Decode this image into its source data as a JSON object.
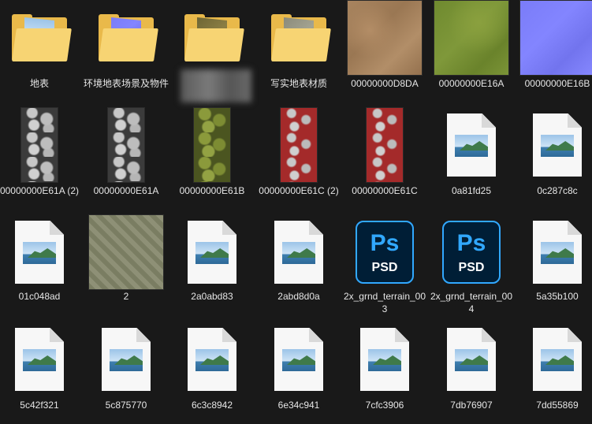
{
  "explorer": {
    "items": [
      {
        "kind": "folder",
        "label": "地表",
        "paper": "photo"
      },
      {
        "kind": "folder",
        "label": "环境地表场景及物件",
        "paper": "normal"
      },
      {
        "kind": "folder",
        "label": "",
        "paper": "stone",
        "blurred": true
      },
      {
        "kind": "folder",
        "label": "写实地表材质",
        "paper": "rock"
      },
      {
        "kind": "texture",
        "label": "00000000D8DA",
        "texture": "sand"
      },
      {
        "kind": "texture",
        "label": "00000000E16A",
        "texture": "grass"
      },
      {
        "kind": "texture",
        "label": "00000000E16B",
        "texture": "normal"
      },
      {
        "kind": "texture-tall",
        "label": "00000000E61A (2)",
        "texture": "gray-rock"
      },
      {
        "kind": "texture-tall",
        "label": "00000000E61A",
        "texture": "gray-rock"
      },
      {
        "kind": "texture-tall",
        "label": "00000000E61B",
        "texture": "moss-rock"
      },
      {
        "kind": "texture-tall",
        "label": "00000000E61C (2)",
        "texture": "red-rock"
      },
      {
        "kind": "texture-tall",
        "label": "00000000E61C",
        "texture": "red-rock"
      },
      {
        "kind": "image",
        "label": "0a81fd25"
      },
      {
        "kind": "image",
        "label": "0c287c8c"
      },
      {
        "kind": "image",
        "label": "01c048ad"
      },
      {
        "kind": "texture",
        "label": "2",
        "texture": "herringbone"
      },
      {
        "kind": "image",
        "label": "2a0abd83"
      },
      {
        "kind": "image",
        "label": "2abd8d0a"
      },
      {
        "kind": "psd",
        "label": "2x_grnd_terrain_003",
        "ps": "Ps",
        "ext": "PSD"
      },
      {
        "kind": "psd",
        "label": "2x_grnd_terrain_004",
        "ps": "Ps",
        "ext": "PSD"
      },
      {
        "kind": "image",
        "label": "5a35b100"
      },
      {
        "kind": "image",
        "label": "5c42f321"
      },
      {
        "kind": "image",
        "label": "5c875770"
      },
      {
        "kind": "image",
        "label": "6c3c8942"
      },
      {
        "kind": "image",
        "label": "6e34c941"
      },
      {
        "kind": "image",
        "label": "7cfc3906"
      },
      {
        "kind": "image",
        "label": "7db76907"
      },
      {
        "kind": "image",
        "label": "7dd55869"
      }
    ]
  },
  "colors": {
    "background": "#191919",
    "folder": "#e9b94a",
    "folder_front": "#f7d473",
    "psd_blue": "#31a8ff",
    "psd_bg": "#001e36"
  }
}
